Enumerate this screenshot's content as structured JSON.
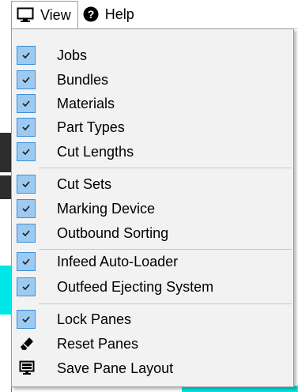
{
  "menubar": {
    "view_label": "View",
    "help_label": "Help"
  },
  "menu": {
    "items": [
      {
        "label": "Jobs",
        "checked": true
      },
      {
        "label": "Bundles",
        "checked": true
      },
      {
        "label": "Materials",
        "checked": true
      },
      {
        "label": "Part Types",
        "checked": true
      },
      {
        "label": "Cut Lengths",
        "checked": true
      },
      {
        "label": "Cut Sets",
        "checked": true
      },
      {
        "label": "Marking Device",
        "checked": true
      },
      {
        "label": "Outbound Sorting",
        "checked": true
      },
      {
        "label": "Infeed Auto-Loader",
        "checked": true
      },
      {
        "label": "Outfeed Ejecting System",
        "checked": true
      },
      {
        "label": "Lock Panes",
        "checked": true
      },
      {
        "label": "Reset Panes",
        "icon": "eraser-icon"
      },
      {
        "label": "Save Pane Layout",
        "icon": "monitor-save-icon"
      }
    ]
  },
  "colors": {
    "check_fill": "#9ccaf0",
    "check_border": "#3c8fd8",
    "background_accent": "#00e5e5"
  }
}
